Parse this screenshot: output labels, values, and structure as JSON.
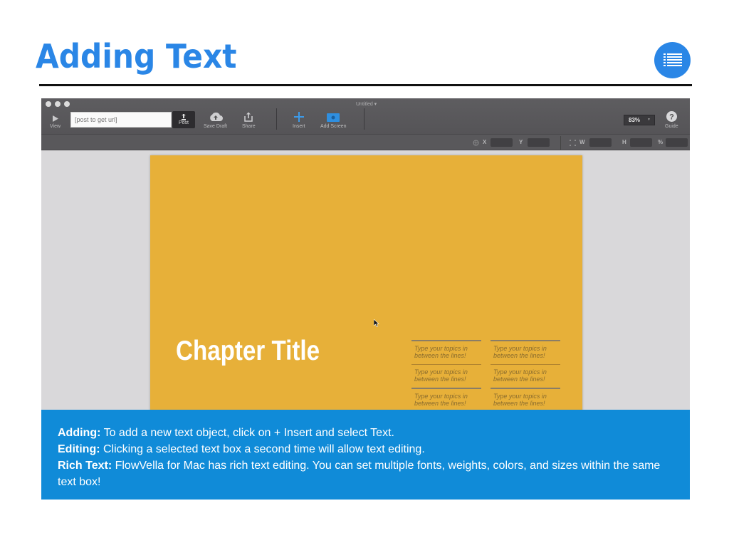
{
  "slide": {
    "title": "Adding Text",
    "menu_icon": "list-icon",
    "accent_color": "#2a86e6"
  },
  "app": {
    "window_title": "Untitled ▾",
    "toolbar": {
      "view_label": "View",
      "url_placeholder": "[post to get url]",
      "post_label": "Post",
      "save_draft_label": "Save Draft",
      "share_label": "Share",
      "insert_label": "Insert",
      "add_screen_label": "Add Screen",
      "zoom_value": "83%",
      "guide_label": "Guide"
    },
    "subbar": {
      "x_label": "X",
      "y_label": "Y",
      "w_label": "W",
      "h_label": "H",
      "pct_label": "%"
    },
    "canvas": {
      "background": "#e7b039",
      "chapter_title": "Chapter Title",
      "topics": [
        [
          "Type your topics in between the lines!",
          "Type your topics in between the lines!",
          "Type your topics in between the lines!"
        ],
        [
          "Type your topics in between the lines!",
          "Type your topics in between the lines!",
          "Type your topics in between the lines!"
        ]
      ]
    }
  },
  "info": {
    "items": [
      {
        "label": "Adding:",
        "text": " To add a new text object, click on + Insert and select Text."
      },
      {
        "label": "Editing:",
        "text": " Clicking a selected text box a second time will allow text editing."
      },
      {
        "label": "Rich Text:",
        "text": " FlowVella for Mac has rich text editing. You can set multiple fonts, weights, colors, and sizes within the same text box!"
      }
    ],
    "background": "#108bd8"
  }
}
